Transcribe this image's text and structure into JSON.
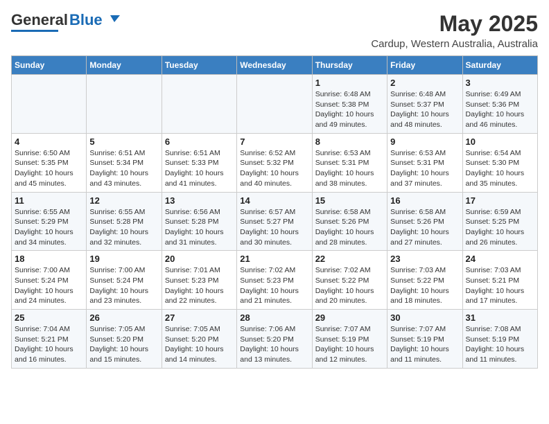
{
  "header": {
    "logo_general": "General",
    "logo_blue": "Blue",
    "title": "May 2025",
    "subtitle": "Cardup, Western Australia, Australia"
  },
  "weekdays": [
    "Sunday",
    "Monday",
    "Tuesday",
    "Wednesday",
    "Thursday",
    "Friday",
    "Saturday"
  ],
  "weeks": [
    [
      {
        "day": "",
        "content": ""
      },
      {
        "day": "",
        "content": ""
      },
      {
        "day": "",
        "content": ""
      },
      {
        "day": "",
        "content": ""
      },
      {
        "day": "1",
        "content": "Sunrise: 6:48 AM\nSunset: 5:38 PM\nDaylight: 10 hours and 49 minutes."
      },
      {
        "day": "2",
        "content": "Sunrise: 6:48 AM\nSunset: 5:37 PM\nDaylight: 10 hours and 48 minutes."
      },
      {
        "day": "3",
        "content": "Sunrise: 6:49 AM\nSunset: 5:36 PM\nDaylight: 10 hours and 46 minutes."
      }
    ],
    [
      {
        "day": "4",
        "content": "Sunrise: 6:50 AM\nSunset: 5:35 PM\nDaylight: 10 hours and 45 minutes."
      },
      {
        "day": "5",
        "content": "Sunrise: 6:51 AM\nSunset: 5:34 PM\nDaylight: 10 hours and 43 minutes."
      },
      {
        "day": "6",
        "content": "Sunrise: 6:51 AM\nSunset: 5:33 PM\nDaylight: 10 hours and 41 minutes."
      },
      {
        "day": "7",
        "content": "Sunrise: 6:52 AM\nSunset: 5:32 PM\nDaylight: 10 hours and 40 minutes."
      },
      {
        "day": "8",
        "content": "Sunrise: 6:53 AM\nSunset: 5:31 PM\nDaylight: 10 hours and 38 minutes."
      },
      {
        "day": "9",
        "content": "Sunrise: 6:53 AM\nSunset: 5:31 PM\nDaylight: 10 hours and 37 minutes."
      },
      {
        "day": "10",
        "content": "Sunrise: 6:54 AM\nSunset: 5:30 PM\nDaylight: 10 hours and 35 minutes."
      }
    ],
    [
      {
        "day": "11",
        "content": "Sunrise: 6:55 AM\nSunset: 5:29 PM\nDaylight: 10 hours and 34 minutes."
      },
      {
        "day": "12",
        "content": "Sunrise: 6:55 AM\nSunset: 5:28 PM\nDaylight: 10 hours and 32 minutes."
      },
      {
        "day": "13",
        "content": "Sunrise: 6:56 AM\nSunset: 5:28 PM\nDaylight: 10 hours and 31 minutes."
      },
      {
        "day": "14",
        "content": "Sunrise: 6:57 AM\nSunset: 5:27 PM\nDaylight: 10 hours and 30 minutes."
      },
      {
        "day": "15",
        "content": "Sunrise: 6:58 AM\nSunset: 5:26 PM\nDaylight: 10 hours and 28 minutes."
      },
      {
        "day": "16",
        "content": "Sunrise: 6:58 AM\nSunset: 5:26 PM\nDaylight: 10 hours and 27 minutes."
      },
      {
        "day": "17",
        "content": "Sunrise: 6:59 AM\nSunset: 5:25 PM\nDaylight: 10 hours and 26 minutes."
      }
    ],
    [
      {
        "day": "18",
        "content": "Sunrise: 7:00 AM\nSunset: 5:24 PM\nDaylight: 10 hours and 24 minutes."
      },
      {
        "day": "19",
        "content": "Sunrise: 7:00 AM\nSunset: 5:24 PM\nDaylight: 10 hours and 23 minutes."
      },
      {
        "day": "20",
        "content": "Sunrise: 7:01 AM\nSunset: 5:23 PM\nDaylight: 10 hours and 22 minutes."
      },
      {
        "day": "21",
        "content": "Sunrise: 7:02 AM\nSunset: 5:23 PM\nDaylight: 10 hours and 21 minutes."
      },
      {
        "day": "22",
        "content": "Sunrise: 7:02 AM\nSunset: 5:22 PM\nDaylight: 10 hours and 20 minutes."
      },
      {
        "day": "23",
        "content": "Sunrise: 7:03 AM\nSunset: 5:22 PM\nDaylight: 10 hours and 18 minutes."
      },
      {
        "day": "24",
        "content": "Sunrise: 7:03 AM\nSunset: 5:21 PM\nDaylight: 10 hours and 17 minutes."
      }
    ],
    [
      {
        "day": "25",
        "content": "Sunrise: 7:04 AM\nSunset: 5:21 PM\nDaylight: 10 hours and 16 minutes."
      },
      {
        "day": "26",
        "content": "Sunrise: 7:05 AM\nSunset: 5:20 PM\nDaylight: 10 hours and 15 minutes."
      },
      {
        "day": "27",
        "content": "Sunrise: 7:05 AM\nSunset: 5:20 PM\nDaylight: 10 hours and 14 minutes."
      },
      {
        "day": "28",
        "content": "Sunrise: 7:06 AM\nSunset: 5:20 PM\nDaylight: 10 hours and 13 minutes."
      },
      {
        "day": "29",
        "content": "Sunrise: 7:07 AM\nSunset: 5:19 PM\nDaylight: 10 hours and 12 minutes."
      },
      {
        "day": "30",
        "content": "Sunrise: 7:07 AM\nSunset: 5:19 PM\nDaylight: 10 hours and 11 minutes."
      },
      {
        "day": "31",
        "content": "Sunrise: 7:08 AM\nSunset: 5:19 PM\nDaylight: 10 hours and 11 minutes."
      }
    ]
  ]
}
